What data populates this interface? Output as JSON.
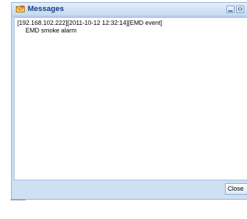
{
  "window": {
    "title": "Messages",
    "icon": "envelope-icon",
    "minimize_icon": "minimize-icon",
    "maximize_icon": "maximize-icon"
  },
  "message": {
    "header": "[192.168.102.222][2011-10-12 12:32:14][EMD event]",
    "text": "EMD smoke alarm"
  },
  "footer": {
    "close_label": "Close"
  },
  "colors": {
    "title_text": "#15428b",
    "window_bg": "#cfe0f3",
    "border": "#99bbe8"
  }
}
